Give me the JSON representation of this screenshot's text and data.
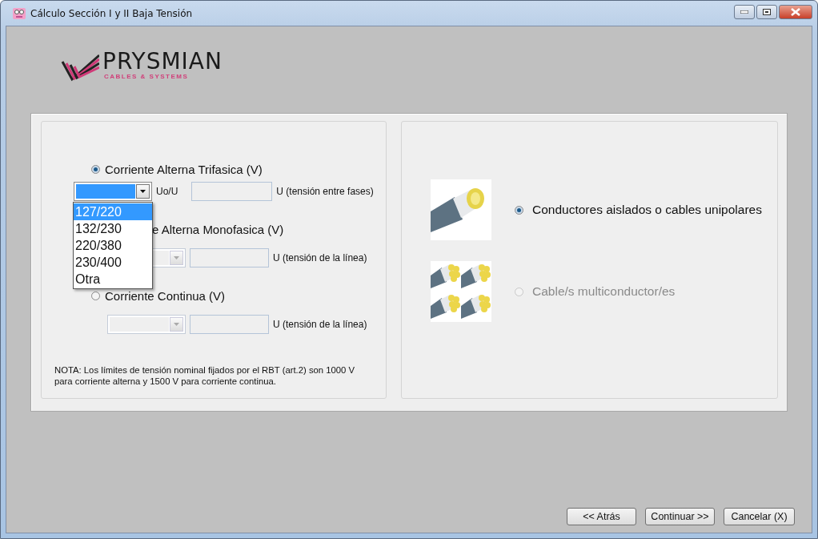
{
  "window": {
    "title": "Cálculo Sección I y II Baja Tensión"
  },
  "logo": {
    "name": "PRYSMIAN",
    "tagline": "CABLES & SYSTEMS"
  },
  "voltage_panel": {
    "options": [
      {
        "kind": "radio",
        "label": "Corriente Alterna Trifasica (V)",
        "selected": true,
        "combo_disabled": false,
        "combo_highlighted": true,
        "combo_label": "Uo/U",
        "field_label": "U (tensión entre fases)"
      },
      {
        "kind": "covered",
        "label": "e Alterna Monofasica (V)",
        "combo_disabled": true,
        "combo_highlighted": false,
        "field_label": "U (tensión de la línea)"
      },
      {
        "kind": "radio",
        "label": "Corriente Continua (V)",
        "selected": false,
        "combo_disabled": true,
        "combo_highlighted": false,
        "field_label": "U (tensión de la línea)"
      }
    ],
    "dropdown": {
      "items": [
        {
          "label": "127/220",
          "selected": true
        },
        {
          "label": "132/230",
          "selected": false
        },
        {
          "label": "220/380",
          "selected": false
        },
        {
          "label": "230/400",
          "selected": false
        },
        {
          "label": "Otra",
          "selected": false
        }
      ]
    },
    "note": "NOTA: Los límites de tensión nominal fijados por el RBT (art.2) son 1000 V para corriente alterna y 1500 V para corriente continua."
  },
  "conductor_panel": {
    "options": [
      {
        "kind": "single",
        "label": "Conductores aislados o cables unipolares",
        "selected": true,
        "disabled": false
      },
      {
        "kind": "multi",
        "label": "Cable/s multiconductor/es",
        "selected": false,
        "disabled": true
      }
    ]
  },
  "buttons": [
    "<< Atrás",
    "Continuar >>",
    "Cancelar (X)"
  ]
}
